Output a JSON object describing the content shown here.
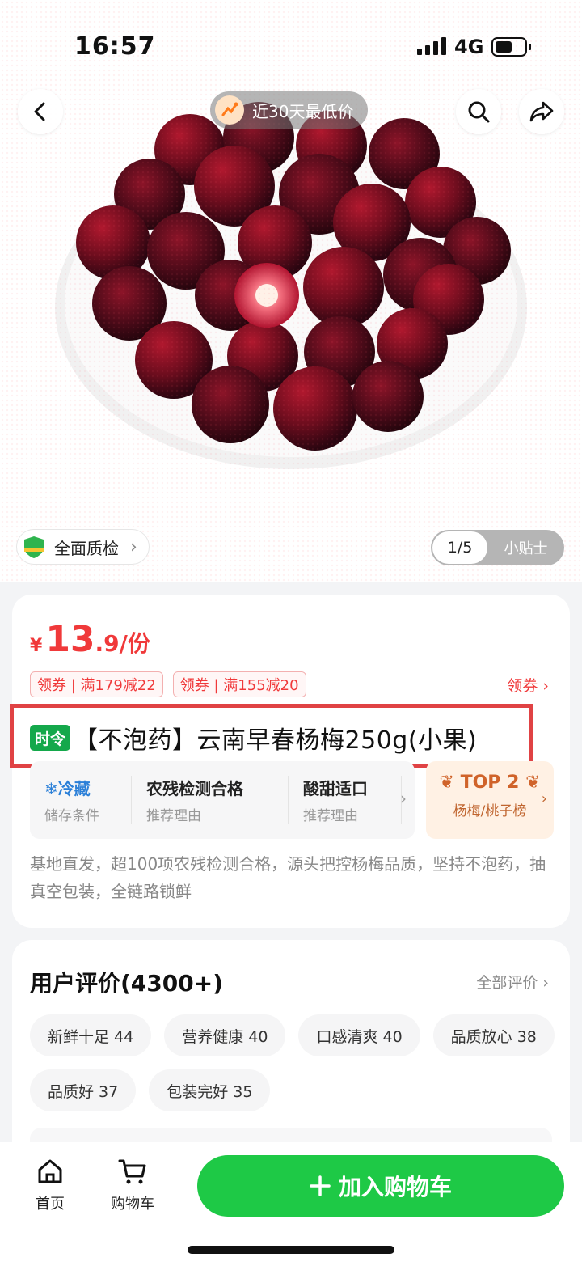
{
  "status": {
    "time": "16:57",
    "network": "4G"
  },
  "header": {
    "price_banner": "近30天最低价"
  },
  "gallery": {
    "quality_label": "全面质检",
    "page_indicator": "1/5",
    "tip_label": "小贴士"
  },
  "product": {
    "currency": "¥",
    "price_int": "13",
    "price_dec": ".9/份",
    "coupons": [
      "领券 | 满179减22",
      "领券 | 满155减20"
    ],
    "coupon_link": "领券",
    "tag": "时令",
    "title": "【不泡药】云南早春杨梅250g(小果)",
    "features": [
      {
        "title": "冷藏",
        "sub": "储存条件"
      },
      {
        "title": "农残检测合格",
        "sub": "推荐理由"
      },
      {
        "title": "酸甜适口",
        "sub": "推荐理由"
      }
    ],
    "ranking": {
      "title": "TOP 2",
      "sub": "杨梅/桃子榜"
    },
    "description": "基地直发，超100项农残检测合格，源头把控杨梅品质，坚持不泡药，抽真空包装，全链路锁鲜"
  },
  "reviews": {
    "title": "用户评价(4300+)",
    "all_label": "全部评价",
    "chips": [
      "新鲜十足 44",
      "营养健康 40",
      "口感清爽 40",
      "品质放心 38",
      "品质好 37",
      "包装完好 35"
    ]
  },
  "bottom": {
    "home_label": "首页",
    "cart_label": "购物车",
    "add_to_cart": "加入购物车"
  },
  "colors": {
    "accent_red": "#f0393a",
    "accent_green": "#1ec946",
    "highlight_box": "#e04244"
  }
}
